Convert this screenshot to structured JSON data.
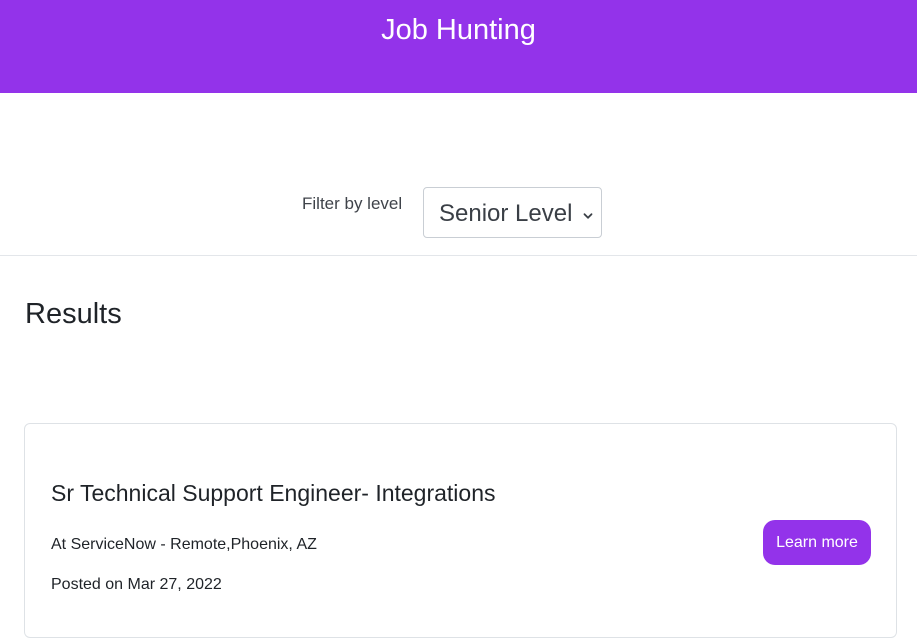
{
  "header": {
    "title": "Job Hunting",
    "background_color": "#9333ea"
  },
  "filter": {
    "label": "Filter by level",
    "selected_value": "Senior Level",
    "icon": "chevron-down-icon"
  },
  "results": {
    "title": "Results",
    "jobs": [
      {
        "title": "Sr Technical Support Engineer- Integrations",
        "company_location": "At ServiceNow - Remote,Phoenix, AZ",
        "posted": "Posted on Mar 27, 2022",
        "action_label": "Learn more"
      }
    ]
  },
  "colors": {
    "accent": "#9333ea"
  }
}
